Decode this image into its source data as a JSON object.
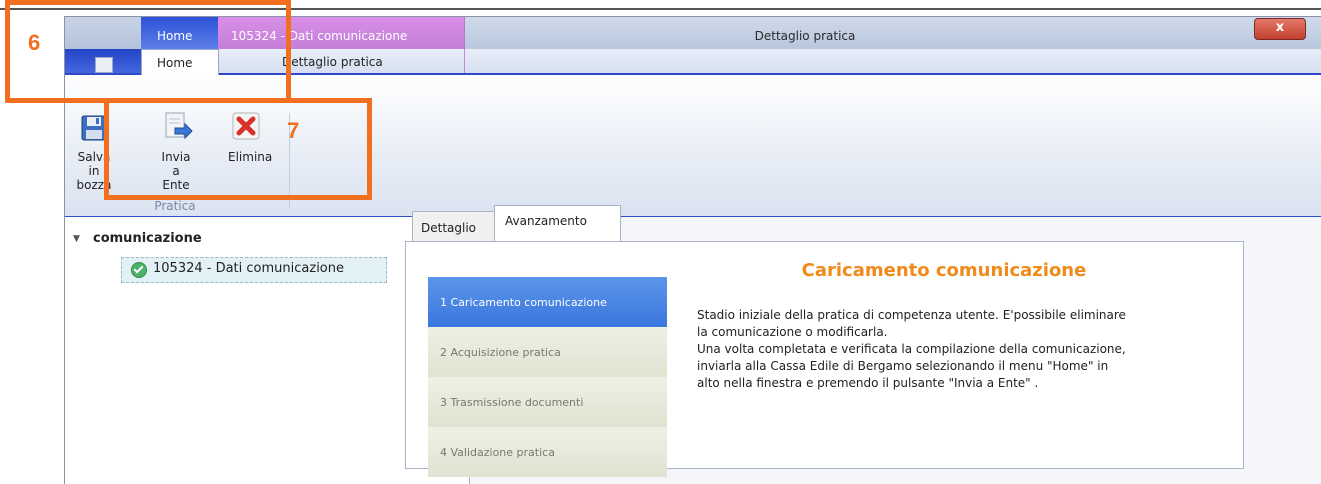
{
  "title_bar": {
    "context_home": "Home",
    "context_pratica": "105324 - Dati comunicazione",
    "window_title": "Dettaglio pratica",
    "close_glyph": "x"
  },
  "tabs": {
    "home": "Home",
    "dettaglio_pratica": "Dettaglio pratica"
  },
  "ribbon": {
    "buttons": [
      {
        "label_line1": "Salva in",
        "label_line2": "bozza",
        "icon": "floppy-disk-icon"
      },
      {
        "label_line1": "Invia a",
        "label_line2": "Ente",
        "icon": "send-document-icon"
      },
      {
        "label_line1": "Elimina",
        "label_line2": "",
        "icon": "delete-x-icon"
      }
    ],
    "group_label": "Pratica"
  },
  "tree": {
    "root": "comunicazione",
    "node": "105324 - Dati comunicazione"
  },
  "detail_tabs": {
    "dettaglio": "Dettaglio",
    "avanzamento": "Avanzamento"
  },
  "steps": [
    {
      "label": "1   Caricamento comunicazione",
      "active": true
    },
    {
      "label": "2   Acquisizione pratica",
      "active": false
    },
    {
      "label": "3   Trasmissione documenti",
      "active": false
    },
    {
      "label": "4   Validazione pratica",
      "active": false
    }
  ],
  "detail": {
    "title": "Caricamento comunicazione",
    "line1": "Stadio iniziale della pratica di competenza utente. E'possibile eliminare",
    "line2": "la comunicazione o modificarla.",
    "line3": "Una volta completata e verificata la compilazione della comunicazione,",
    "line4": "inviarla alla Cassa Edile di Bergamo selezionando il menu \"Home\" in",
    "line5": "alto nella finestra e premendo il pulsante \"Invia a Ente\" ."
  },
  "annotations": {
    "marker_6": "6",
    "marker_7": "7",
    "color": "#f26f1f"
  },
  "colors": {
    "accent_blue": "#2f49c8",
    "context_purple": "#c57fd8",
    "title_orange": "#f08a1a",
    "active_step": "#3a77de"
  }
}
